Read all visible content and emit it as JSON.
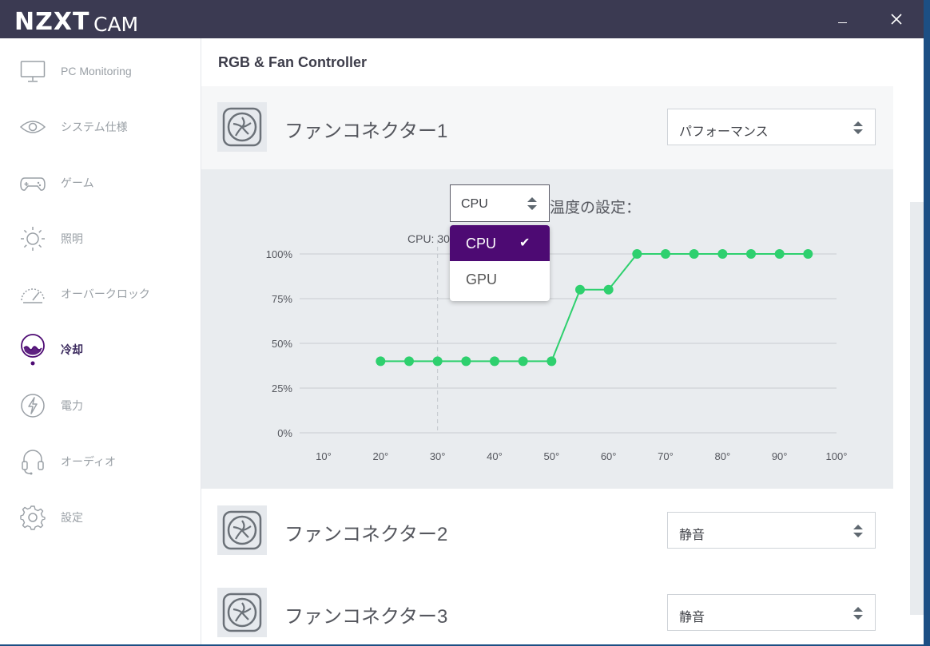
{
  "app": {
    "logo": "NZXT",
    "name": "CAM",
    "minimize_glyph": "—",
    "close_glyph": "✕"
  },
  "sidebar": {
    "items": [
      {
        "label": "PC Monitoring",
        "icon": "monitor-icon"
      },
      {
        "label": "システム仕様",
        "icon": "eye-icon"
      },
      {
        "label": "ゲーム",
        "icon": "gamepad-icon"
      },
      {
        "label": "照明",
        "icon": "sun-icon"
      },
      {
        "label": "オーバークロック",
        "icon": "gauge-icon"
      },
      {
        "label": "冷却",
        "icon": "cooling-icon",
        "active": true
      },
      {
        "label": "電力",
        "icon": "bolt-icon"
      },
      {
        "label": "オーディオ",
        "icon": "headset-icon"
      },
      {
        "label": "設定",
        "icon": "gear-icon"
      }
    ]
  },
  "main": {
    "title": "RGB & Fan Controller",
    "fans": [
      {
        "name": "ファンコネクター1",
        "profile": "パフォーマンス"
      },
      {
        "name": "ファンコネクター2",
        "profile": "静音"
      },
      {
        "name": "ファンコネクター3",
        "profile": "静音"
      }
    ],
    "curve": {
      "source_value": "CPU",
      "temp_label": "温度の設定：",
      "cursor_label": "CPU: 30"
    },
    "dropdown": {
      "options": [
        {
          "label": "CPU",
          "selected": true
        },
        {
          "label": "GPU",
          "selected": false
        }
      ],
      "check_glyph": "✔"
    }
  },
  "chart_data": {
    "type": "line",
    "x": [
      20,
      25,
      30,
      35,
      40,
      45,
      50,
      55,
      60,
      65,
      70,
      75,
      80,
      85,
      90,
      95
    ],
    "y": [
      40,
      40,
      40,
      40,
      40,
      40,
      40,
      80,
      80,
      100,
      100,
      100,
      100,
      100,
      100,
      100
    ],
    "x_ticks": [
      "10°",
      "20°",
      "30°",
      "40°",
      "50°",
      "60°",
      "70°",
      "80°",
      "90°",
      "100°"
    ],
    "x_tick_values": [
      10,
      20,
      30,
      40,
      50,
      60,
      70,
      80,
      90,
      100
    ],
    "y_ticks": [
      "0%",
      "25%",
      "50%",
      "75%",
      "100%"
    ],
    "y_tick_values": [
      0,
      25,
      50,
      75,
      100
    ],
    "xlim": [
      10,
      100
    ],
    "ylim": [
      0,
      100
    ],
    "cursor_x": 30,
    "grid": true,
    "color": "#2ed06e"
  }
}
